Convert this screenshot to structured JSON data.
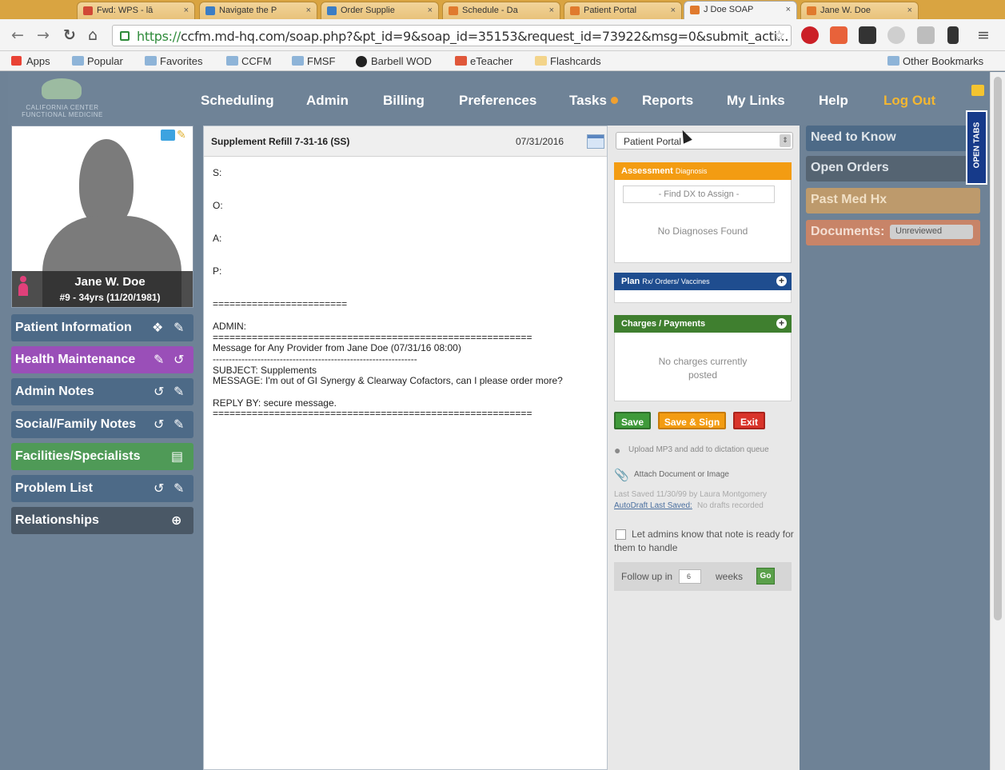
{
  "browser": {
    "tabs": [
      {
        "label": "Fwd: WPS - lā"
      },
      {
        "label": "Navigate the P"
      },
      {
        "label": "Order Supplie"
      },
      {
        "label": "Schedule - Da"
      },
      {
        "label": "Patient Portal"
      },
      {
        "label": "J Doe SOAP"
      },
      {
        "label": "Jane W. Doe"
      }
    ],
    "close_glyph": "×",
    "url_scheme": "https://",
    "url_rest": "ccfm.md-hq.com/soap.php?&pt_id=9&soap_id=35153&request_id=73922&msg=0&submit_acti...",
    "bookmarks": [
      "Apps",
      "Popular",
      "Favorites",
      "CCFM",
      "FMSF",
      "Barbell WOD",
      "eTeacher",
      "Flashcards"
    ],
    "other_bookmarks": "Other Bookmarks"
  },
  "header": {
    "logo_line1": "CALIFORNIA CENTER",
    "logo_line2": "FUNCTIONAL MEDICINE",
    "nav": [
      "Scheduling",
      "Admin",
      "Billing",
      "Preferences",
      "Tasks",
      "Reports",
      "My Links",
      "Help",
      "Log Out"
    ]
  },
  "patient": {
    "name": "Jane W. Doe",
    "meta": "#9 - 34yrs (11/20/1981)"
  },
  "sidebar": {
    "items": [
      {
        "label": "Patient Information",
        "color": "#4d6a87"
      },
      {
        "label": "Health Maintenance",
        "color": "#9a4fb8"
      },
      {
        "label": "Admin Notes",
        "color": "#4d6a87"
      },
      {
        "label": "Social/Family Notes",
        "color": "#4d6a87"
      },
      {
        "label": "Facilities/Specialists",
        "color": "#4f9a57"
      },
      {
        "label": "Problem List",
        "color": "#4d6a87"
      },
      {
        "label": "Relationships",
        "color": "#4a5866"
      }
    ]
  },
  "note": {
    "title": "Supplement Refill 7-31-16  (SS)",
    "date": "07/31/2016",
    "body": "S:\n\n\nO:\n\n\nA:\n\n\nP:\n\n\n========================\n\nADMIN:\n=========================================================\nMessage for Any Provider from Jane Doe (07/31/16 08:00)\n----------------------------------------------------------------\nSUBJECT: Supplements\nMESSAGE: I'm out of GI Synergy & Clearway Cofactors, can I please order more?\n\nREPLY BY: secure message.\n========================================================="
  },
  "middle": {
    "dropdown_value": "Patient Portal",
    "assessment": {
      "title": "Assessment",
      "sub": "Diagnosis",
      "find_placeholder": "- Find DX to Assign -",
      "empty": "No Diagnoses Found",
      "color": "#f39c12"
    },
    "plan": {
      "title": "Plan",
      "sub": "Rx/ Orders/ Vaccines",
      "color": "#1f4d8f"
    },
    "charges": {
      "title": "Charges / Payments",
      "empty_line1": "No charges currently",
      "empty_line2": "posted",
      "color": "#3f7f2f"
    },
    "buttons": {
      "save": "Save",
      "save_sign": "Save & Sign",
      "exit": "Exit"
    },
    "upload": "Upload MP3 and add to dictation queue",
    "attach": "Attach Document or Image",
    "last_saved": "Last Saved 11/30/99 by Laura Montgomery",
    "autodraft_link": "AutoDraft Last Saved:",
    "autodraft_text": "No drafts recorded",
    "admins_text": "Let admins know that note is ready for them to handle",
    "followup_label": "Follow up in",
    "followup_value": "6",
    "followup_unit": "weeks",
    "go": "Go"
  },
  "right": {
    "need_to_know": "Need to Know",
    "open_orders": "Open Orders",
    "past_med_hx": "Past Med Hx",
    "documents": "Documents:",
    "documents_filter": "Unreviewed",
    "open_tabs": "OPEN TABS"
  }
}
